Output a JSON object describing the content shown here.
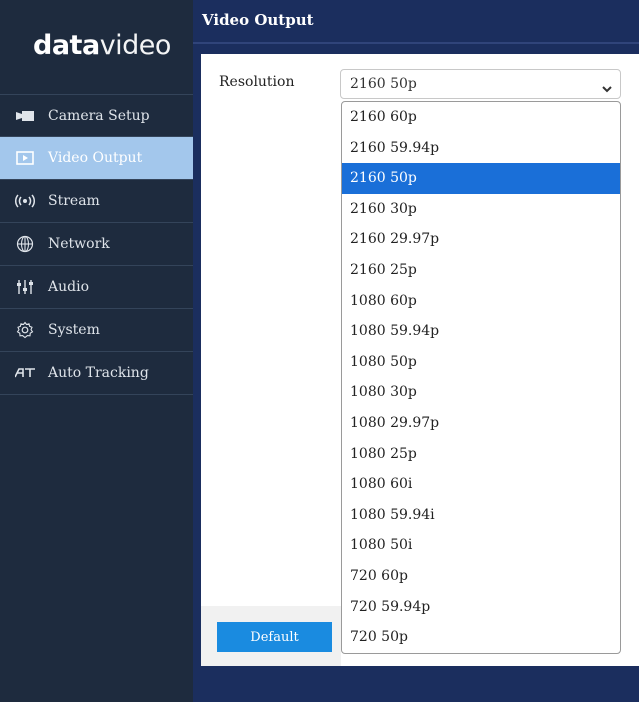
{
  "logo": {
    "bold": "data",
    "light": "video"
  },
  "header": {
    "title": "Video Output"
  },
  "sidebar": {
    "items": [
      {
        "label": "Camera Setup",
        "icon": "camera-icon",
        "active": false
      },
      {
        "label": "Video Output",
        "icon": "video-output-icon",
        "active": true
      },
      {
        "label": "Stream",
        "icon": "stream-icon",
        "active": false
      },
      {
        "label": "Network",
        "icon": "globe-icon",
        "active": false
      },
      {
        "label": "Audio",
        "icon": "audio-sliders-icon",
        "active": false
      },
      {
        "label": "System",
        "icon": "gear-icon",
        "active": false
      },
      {
        "label": "Auto Tracking",
        "icon": "auto-tracking-icon",
        "active": false
      }
    ]
  },
  "resolution": {
    "label": "Resolution",
    "value": "2160 50p",
    "options": [
      "2160 60p",
      "2160 59.94p",
      "2160 50p",
      "2160 30p",
      "2160 29.97p",
      "2160 25p",
      "1080 60p",
      "1080 59.94p",
      "1080 50p",
      "1080 30p",
      "1080 29.97p",
      "1080 25p",
      "1080 60i",
      "1080 59.94i",
      "1080 50i",
      "720 60p",
      "720 59.94p",
      "720 50p"
    ]
  },
  "buttons": {
    "default_label": "Default"
  },
  "colors": {
    "accent": "#1a6fd8",
    "sidebar_bg": "#1e2b3e",
    "active_item": "#a3c7ec",
    "header_bg": "#1b2e5e",
    "default_button": "#1a8be0"
  }
}
